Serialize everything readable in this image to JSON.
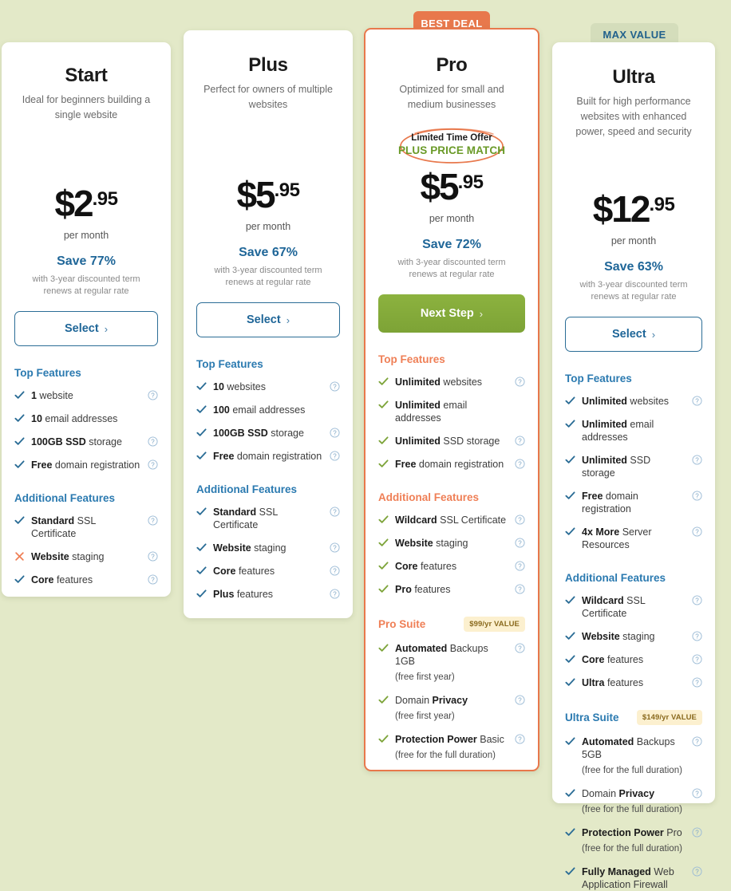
{
  "background_color": "#e3e9c8",
  "badges": [
    {
      "id": "best-deal",
      "label": "BEST DEAL",
      "bg": "#e8784c",
      "color": "#ffffff"
    },
    {
      "id": "max-value",
      "label": "MAX VALUE",
      "bg": "#d4ddbb",
      "color": "#21618c"
    }
  ],
  "common": {
    "per_month": "per month",
    "terms_line1": "with 3-year discounted term",
    "terms_line2": "renews at regular rate",
    "top_features_label": "Top Features",
    "additional_features_label": "Additional Features",
    "help_icon": "question-mark-circle-icon",
    "check_icon": "check-icon",
    "cross_icon": "cross-icon",
    "chevron": "›"
  },
  "plans": [
    {
      "id": "start",
      "name": "Start",
      "desc": "Ideal for beginners building a single website",
      "currency": "$",
      "amount": "2",
      "cents": ".95",
      "save": "Save 77%",
      "cta": "Select",
      "cta_style": "outline",
      "accent": "#2b7ab0",
      "check_color": "#2b6d96",
      "top_features": [
        {
          "bold": "1",
          "rest": " website",
          "help": true
        },
        {
          "bold": "10",
          "rest": " email addresses",
          "help": false
        },
        {
          "bold": "100GB SSD",
          "rest": " storage",
          "help": true
        },
        {
          "bold": "Free",
          "rest": " domain registration",
          "help": true
        }
      ],
      "additional_features": [
        {
          "bold": "Standard",
          "rest": " SSL Certificate",
          "help": true,
          "mark": "check"
        },
        {
          "bold": "Website",
          "rest": " staging",
          "help": true,
          "mark": "cross"
        },
        {
          "bold": "Core",
          "rest": " features",
          "help": true,
          "mark": "check"
        }
      ],
      "suite": null
    },
    {
      "id": "plus",
      "name": "Plus",
      "desc": "Perfect for owners of multiple websites",
      "currency": "$",
      "amount": "5",
      "cents": ".95",
      "save": "Save 67%",
      "cta": "Select",
      "cta_style": "outline",
      "accent": "#2b7ab0",
      "check_color": "#2b6d96",
      "top_features": [
        {
          "bold": "10",
          "rest": " websites",
          "help": true
        },
        {
          "bold": "100",
          "rest": " email addresses",
          "help": false
        },
        {
          "bold": "100GB SSD",
          "rest": " storage",
          "help": true
        },
        {
          "bold": "Free",
          "rest": " domain registration",
          "help": true
        }
      ],
      "additional_features": [
        {
          "bold": "Standard",
          "rest": " SSL Certificate",
          "help": true,
          "mark": "check"
        },
        {
          "bold": "Website",
          "rest": " staging",
          "help": true,
          "mark": "check"
        },
        {
          "bold": "Core",
          "rest": " features",
          "help": true,
          "mark": "check"
        },
        {
          "bold": "Plus",
          "rest": " features",
          "help": true,
          "mark": "check"
        }
      ],
      "suite": null
    },
    {
      "id": "pro",
      "name": "Pro",
      "desc": "Optimized for small and medium businesses",
      "offer": {
        "line1": "Limited Time Offer",
        "line2": "PLUS PRICE MATCH"
      },
      "currency": "$",
      "amount": "5",
      "cents": ".95",
      "save": "Save 72%",
      "cta": "Next Step",
      "cta_style": "primary",
      "accent": "#ef7f56",
      "check_color": "#7da43a",
      "top_features": [
        {
          "bold": "Unlimited",
          "rest": " websites",
          "help": true
        },
        {
          "bold": "Unlimited",
          "rest": " email addresses",
          "help": false
        },
        {
          "bold": "Unlimited",
          "rest": " SSD storage",
          "help": true
        },
        {
          "bold": "Free",
          "rest": " domain registration",
          "help": true
        }
      ],
      "additional_features": [
        {
          "bold": "Wildcard",
          "rest": " SSL Certificate",
          "help": true,
          "mark": "check"
        },
        {
          "bold": "Website",
          "rest": " staging",
          "help": true,
          "mark": "check"
        },
        {
          "bold": "Core",
          "rest": " features",
          "help": true,
          "mark": "check"
        },
        {
          "bold": "Pro",
          "rest": " features",
          "help": true,
          "mark": "check"
        }
      ],
      "suite": {
        "title": "Pro Suite",
        "value_badge": "$99/yr VALUE",
        "items": [
          {
            "bold": "Automated",
            "rest": " Backups 1GB",
            "sub": "(free first year)",
            "help": true
          },
          {
            "pre": "Domain ",
            "bold": "Privacy",
            "rest": "",
            "sub": "(free first year)",
            "help": true
          },
          {
            "bold": "Protection Power",
            "rest": " Basic",
            "sub": "(free for the full duration)",
            "help": true
          }
        ]
      }
    },
    {
      "id": "ultra",
      "name": "Ultra",
      "desc": "Built for high performance websites with enhanced power, speed and security",
      "currency": "$",
      "amount": "12",
      "cents": ".95",
      "save": "Save 63%",
      "cta": "Select",
      "cta_style": "outline",
      "accent": "#2b7ab0",
      "check_color": "#2b6d96",
      "top_features": [
        {
          "bold": "Unlimited",
          "rest": " websites",
          "help": true
        },
        {
          "bold": "Unlimited",
          "rest": " email addresses",
          "help": false
        },
        {
          "bold": "Unlimited",
          "rest": " SSD storage",
          "help": true
        },
        {
          "bold": "Free",
          "rest": " domain registration",
          "help": true
        },
        {
          "bold": "4x More",
          "rest": " Server Resources",
          "help": true
        }
      ],
      "additional_features": [
        {
          "bold": "Wildcard",
          "rest": " SSL Certificate",
          "help": true,
          "mark": "check"
        },
        {
          "bold": "Website",
          "rest": " staging",
          "help": true,
          "mark": "check"
        },
        {
          "bold": "Core",
          "rest": " features",
          "help": true,
          "mark": "check"
        },
        {
          "bold": "Ultra",
          "rest": " features",
          "help": true,
          "mark": "check"
        }
      ],
      "suite": {
        "title": "Ultra Suite",
        "value_badge": "$149/yr VALUE",
        "items": [
          {
            "bold": "Automated",
            "rest": " Backups 5GB",
            "sub": "(free for the full duration)",
            "help": true
          },
          {
            "pre": "Domain ",
            "bold": "Privacy",
            "rest": "",
            "sub": "(free for the full duration)",
            "help": true
          },
          {
            "bold": "Protection Power",
            "rest": " Pro",
            "sub": "(free for the full duration)",
            "help": true
          },
          {
            "bold": "Fully Managed",
            "rest": " Web Application Firewall",
            "sub": "",
            "help": true
          }
        ]
      }
    }
  ]
}
